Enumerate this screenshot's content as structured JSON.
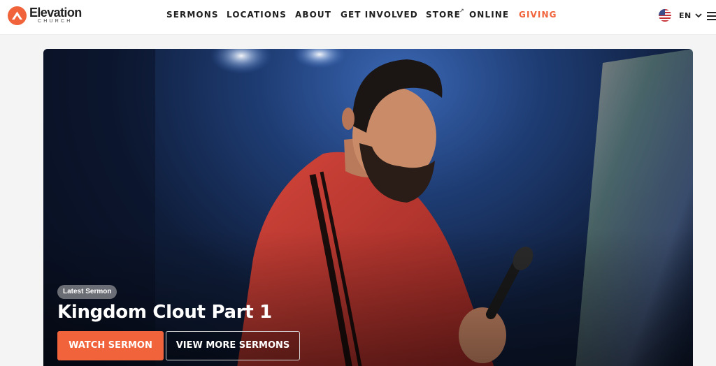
{
  "brand": {
    "name": "Elevation",
    "subtitle": "CHURCH",
    "accent_color": "#f0633b"
  },
  "nav": {
    "items": [
      {
        "label": "SERMONS"
      },
      {
        "label": "LOCATIONS"
      },
      {
        "label": "ABOUT"
      },
      {
        "label": "GET INVOLVED"
      },
      {
        "label": "STORE",
        "external_icon": "external-link-icon"
      },
      {
        "label": "ONLINE"
      },
      {
        "label": "GIVING",
        "color": "#f0633b"
      }
    ]
  },
  "language": {
    "label": "EN",
    "flag_icon": "us-flag-icon",
    "chevron_icon": "chevron-down-icon"
  },
  "menu_icon": "hamburger-menu-icon",
  "hero": {
    "badge": "Latest Sermon",
    "title": "Kingdom Clout Part 1",
    "primary_button": "WATCH SERMON",
    "secondary_button": "VIEW MORE SERMONS",
    "image": "pastor-with-microphone-photo"
  }
}
